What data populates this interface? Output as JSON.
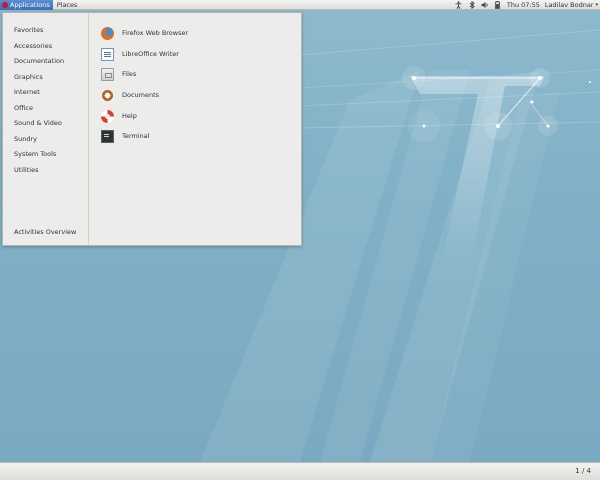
{
  "top_panel": {
    "applications_label": "Applications",
    "places_label": "Places",
    "clock": "Thu 07:55",
    "user_name": "Ladilav Bodnar",
    "tray_icons": [
      "accessibility-icon",
      "bluetooth-icon",
      "volume-icon",
      "battery-icon"
    ]
  },
  "menu": {
    "categories": [
      "Favorites",
      "Accessories",
      "Documentation",
      "Graphics",
      "Internet",
      "Office",
      "Sound & Video",
      "Sundry",
      "System Tools",
      "Utilities"
    ],
    "activities_overview": "Activities Overview",
    "apps": [
      {
        "label": "Firefox Web Browser",
        "icon": "firefox-icon"
      },
      {
        "label": "LibreOffice Writer",
        "icon": "libreoffice-writer-icon"
      },
      {
        "label": "Files",
        "icon": "files-icon"
      },
      {
        "label": "Documents",
        "icon": "documents-icon"
      },
      {
        "label": "Help",
        "icon": "help-icon"
      },
      {
        "label": "Terminal",
        "icon": "terminal-icon"
      }
    ]
  },
  "bottom_panel": {
    "workspace_indicator": "1 / 4"
  }
}
